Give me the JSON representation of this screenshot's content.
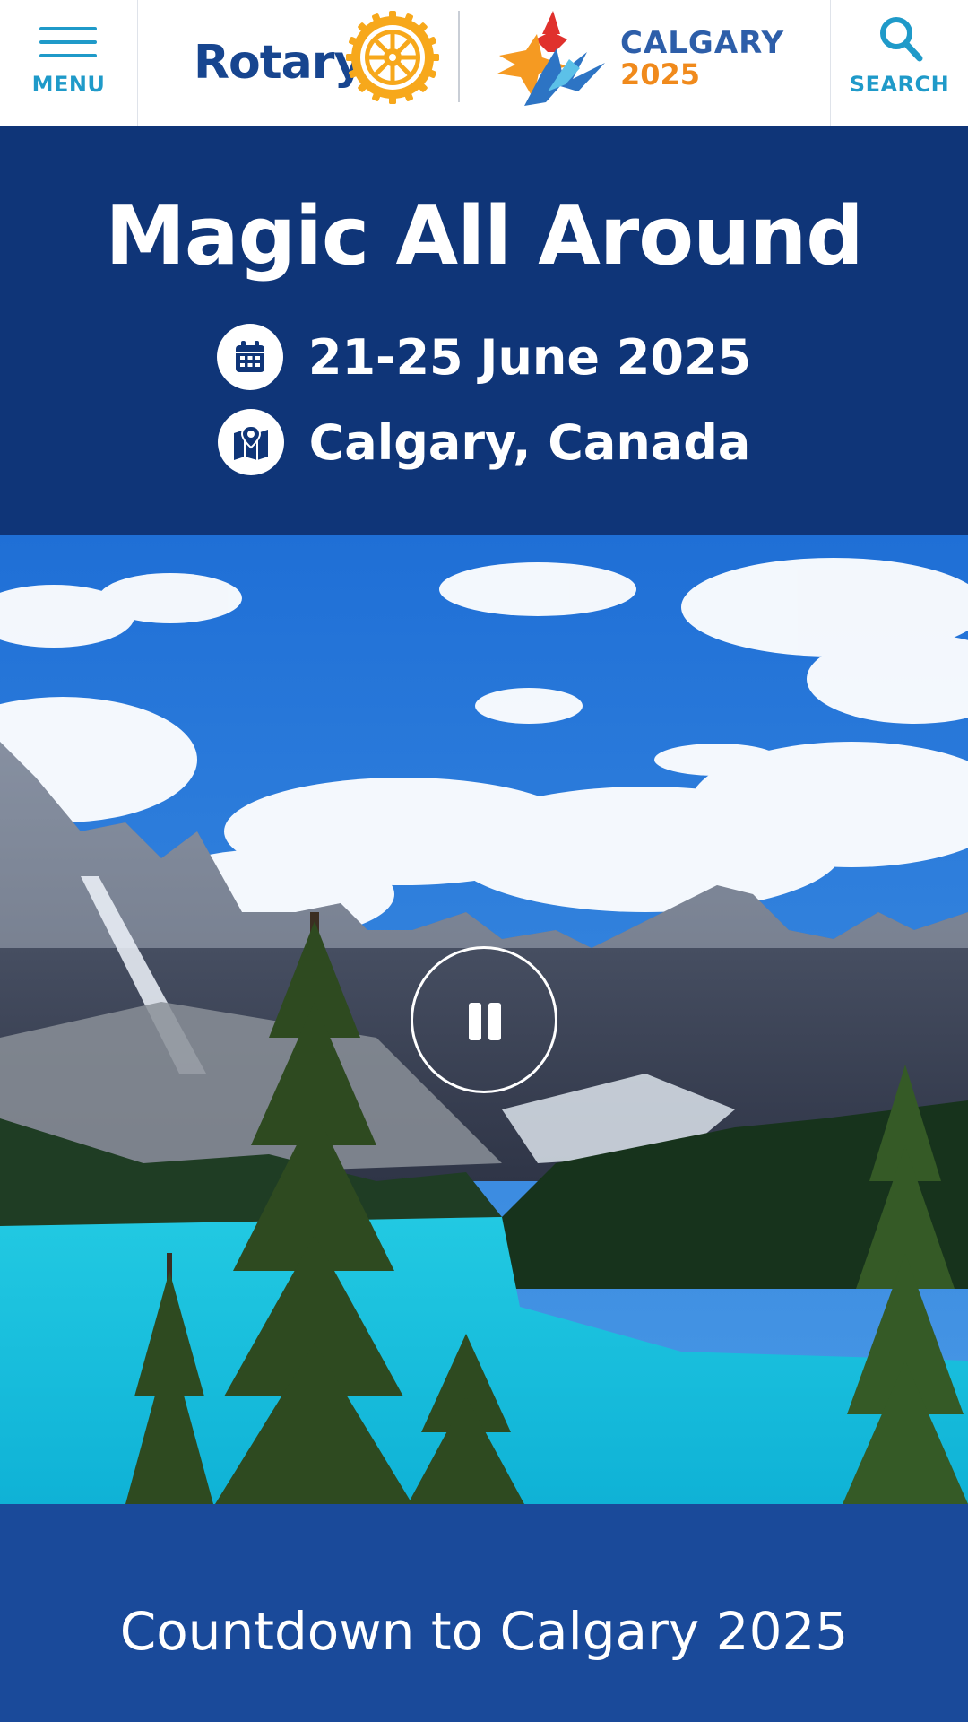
{
  "header": {
    "menu_label": "MENU",
    "search_label": "SEARCH",
    "rotary_word": "Rotary",
    "calgary_word": "CALGARY",
    "calgary_year": "2025"
  },
  "hero": {
    "title": "Magic All Around",
    "date": "21-25 June 2025",
    "location": "Calgary, Canada"
  },
  "icons": {
    "menu": "hamburger-icon",
    "search": "search-icon",
    "date": "calendar-icon",
    "location": "map-icon",
    "video_control": "pause-icon"
  },
  "countdown": {
    "title": "Countdown to Calgary 2025"
  },
  "colors": {
    "navy": "#0f3578",
    "royal_blue": "#1a4a9a",
    "accent_cyan": "#1f9ac9",
    "rotary_gold": "#f7a81b",
    "calgary_orange": "#f08a1c"
  }
}
